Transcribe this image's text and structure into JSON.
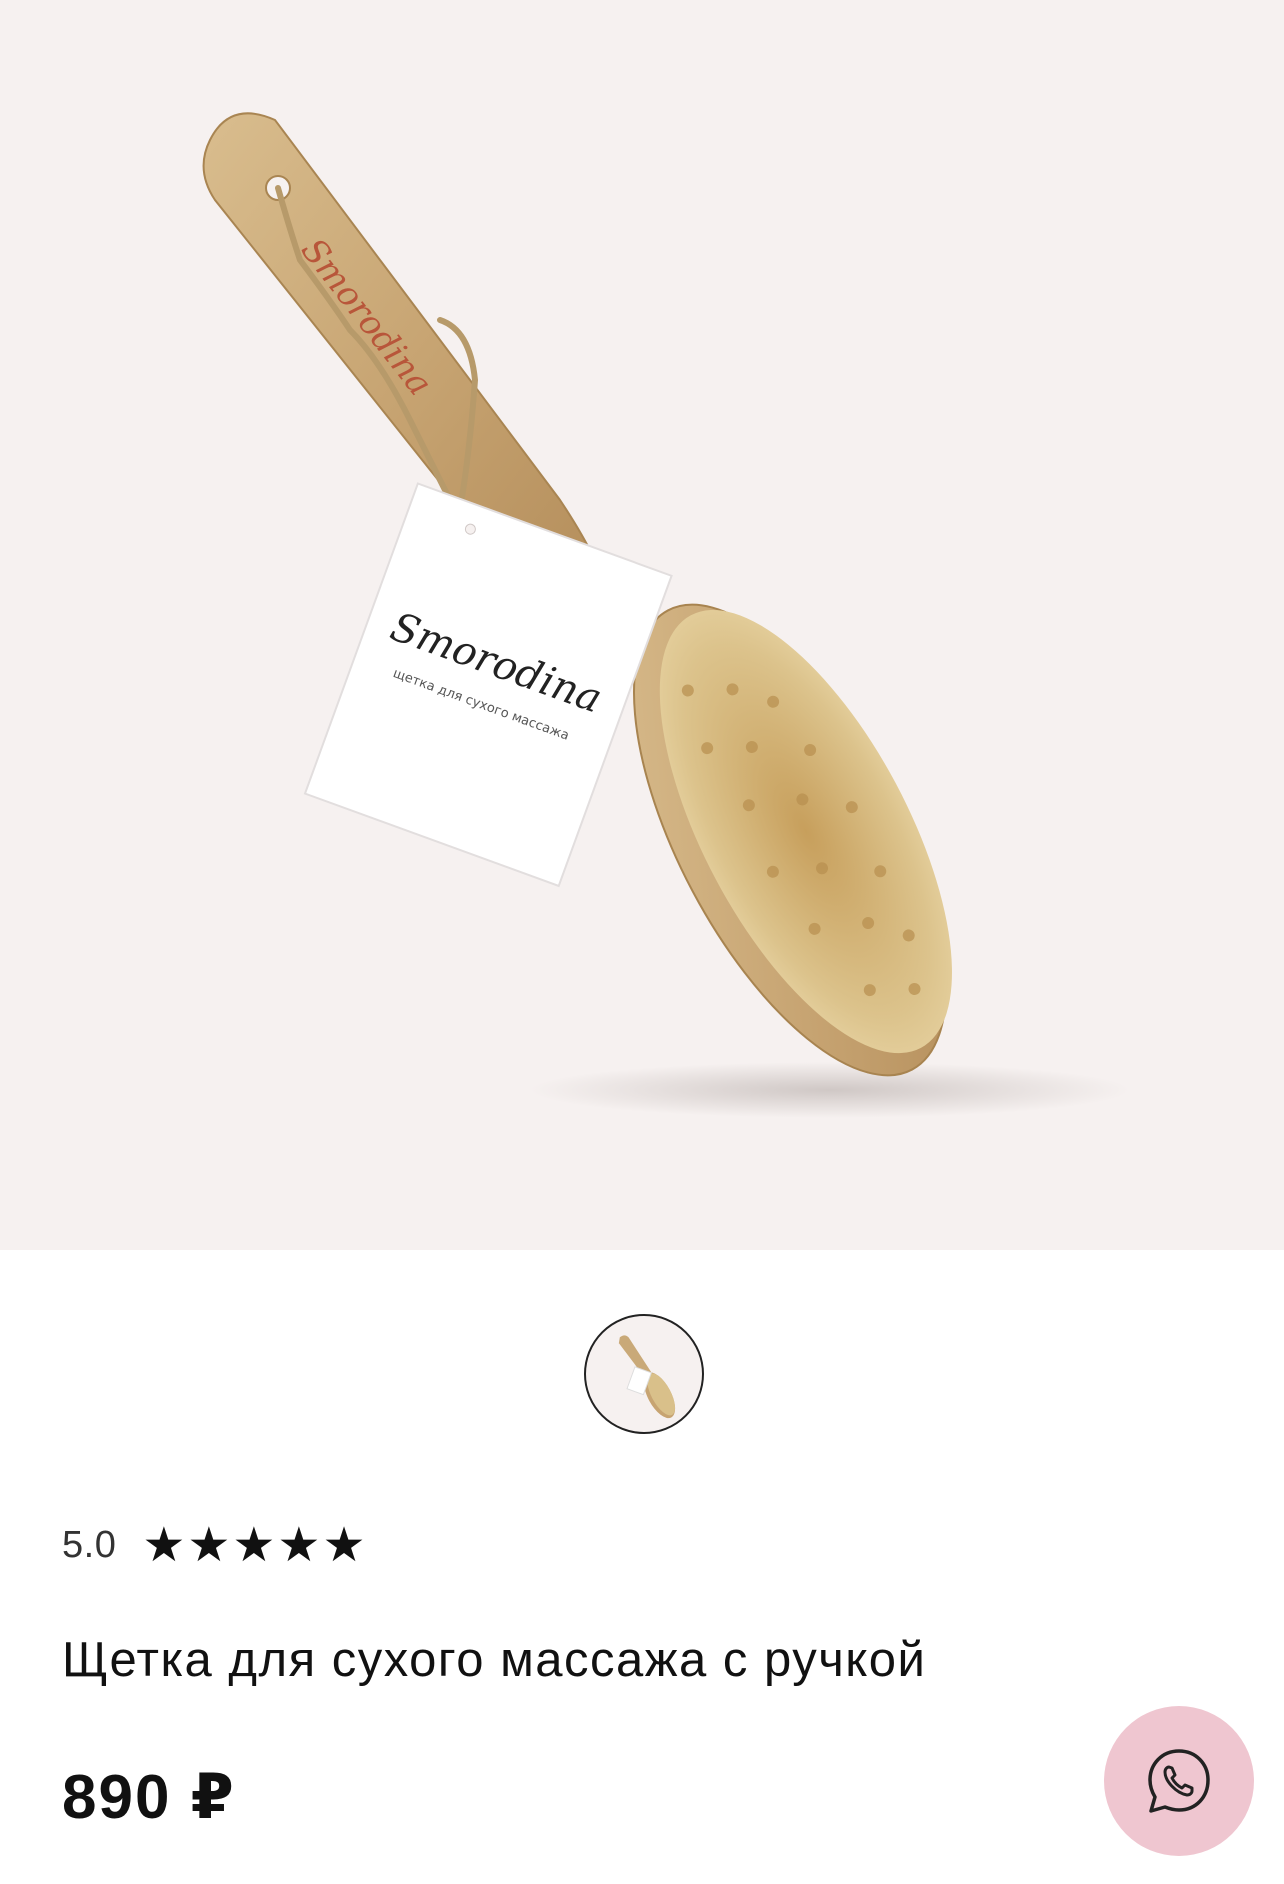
{
  "product": {
    "brand_logo_text": "Smorodina",
    "tag_subtitle": "щетка для сухого массажа",
    "rating_value": "5.0",
    "rating_stars": 5,
    "title": "Щетка для сухого массажа с ручкой",
    "price": "890 ₽"
  },
  "gallery": {
    "images_count": 1,
    "selected_index": 0
  },
  "icons": {
    "star": "star-icon",
    "chat": "whatsapp-icon"
  },
  "colors": {
    "hero_background": "#f6f1f0",
    "chat_button": "#efc6d0",
    "text": "#111111",
    "wood": "#c9a978",
    "bristle": "#d9c08a"
  }
}
